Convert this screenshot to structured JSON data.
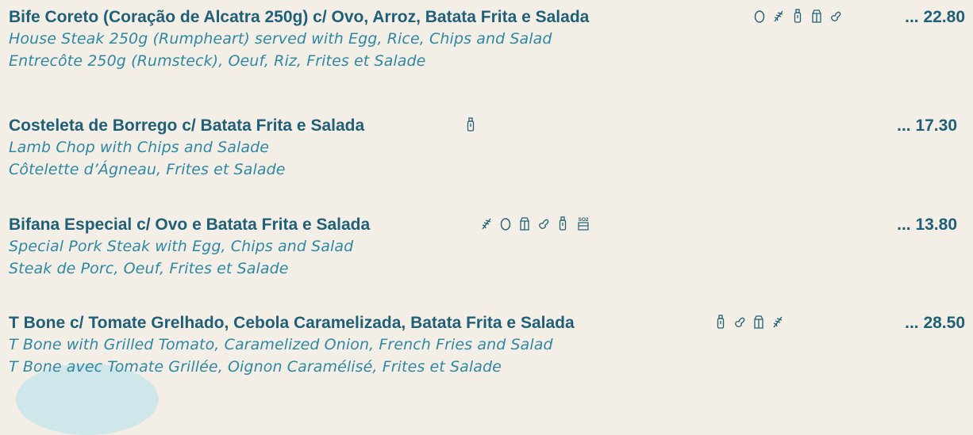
{
  "menu": {
    "items": [
      {
        "title": "Bife Coreto (Coração de Alcatra 250g) c/ Ovo, Arroz, Batata Frita e Salada",
        "en": "House Steak 250g (Rumpheart)  served with Egg, Rice, Chips and Salad",
        "fr": "Entrecôte 250g (Rumsteck), Oeuf, Riz, Frites et Salade",
        "price": "... 22.80",
        "allergens": [
          "egg-icon",
          "wheat-icon",
          "bottle-icon",
          "milk-carton-icon",
          "peanut-icon"
        ]
      },
      {
        "title": "Costeleta de Borrego c/ Batata Frita e Salada",
        "en": "Lamb Chop with Chips and Salade",
        "fr": "Côtelette d’Ágneau, Frites et Salade",
        "price": "... 17.30",
        "allergens": [
          "bottle-icon"
        ]
      },
      {
        "title": "Bifana Especial c/ Ovo e Batata Frita e Salada",
        "en": "Special Pork Steak with Egg, Chips and Salad",
        "fr": "Steak de Porc, Oeuf, Frites et Salade",
        "price": "... 13.80",
        "allergens": [
          "wheat-icon",
          "egg-icon",
          "milk-carton-icon",
          "peanut-icon",
          "bottle-icon",
          "so2-icon"
        ]
      },
      {
        "title": "T Bone c/ Tomate Grelhado, Cebola Caramelizada, Batata Frita e Salada",
        "en": "T Bone with Grilled Tomato, Caramelized Onion, French Fries and Salad",
        "fr": "T Bone avec Tomate Grillée, Oignon Caramélisé, Frites et Salade",
        "price": "... 28.50",
        "allergens": [
          "bottle-icon",
          "peanut-icon",
          "milk-carton-icon",
          "wheat-icon"
        ]
      }
    ],
    "so2_label": "SO2",
    "colors": {
      "title": "#1f5f77",
      "subtitle": "#2e88a3",
      "background": "#f4efe6"
    }
  }
}
